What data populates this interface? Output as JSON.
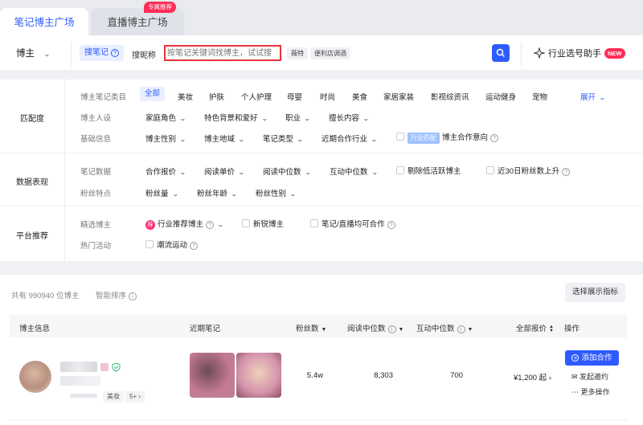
{
  "tabs": [
    {
      "label": "笔记博主广场",
      "active": true
    },
    {
      "label": "直播博主广场",
      "active": false,
      "badge": "专属推荐"
    }
  ],
  "search": {
    "scope": "博主",
    "mode_active": "搜笔记",
    "mode_other": "搜昵称",
    "placeholder": "按笔记关键词找博主，试试搜",
    "chips": [
      "薇特",
      "便利店调酒"
    ],
    "assistant_label": "行业选号助手",
    "assistant_badge": "NEW"
  },
  "filters": {
    "sections": [
      "匹配度",
      "数据表现",
      "平台推荐"
    ],
    "category_row": {
      "label": "博主笔记类目",
      "active": "全部",
      "options": [
        "美妆",
        "护肤",
        "个人护理",
        "母婴",
        "时尚",
        "美食",
        "家居家装",
        "影视综资讯",
        "运动健身",
        "宠物"
      ],
      "expand": "展开"
    },
    "persona_row": {
      "label": "博主人设",
      "options": [
        "家庭角色",
        "特色背景和爱好",
        "职业",
        "擅长内容"
      ]
    },
    "basic_row": {
      "label": "基础信息",
      "options": [
        "博主性别",
        "博主地域",
        "笔记类型",
        "近期合作行业"
      ],
      "tag": "行业匹配",
      "intent": "博主合作意向"
    },
    "notedata_row": {
      "label": "笔记数据",
      "options": [
        "合作报价",
        "阅读单价",
        "阅读中位数",
        "互动中位数"
      ],
      "checks": [
        "剔除低活跃博主",
        "近30日粉丝数上升"
      ]
    },
    "fans_row": {
      "label": "粉丝特点",
      "options": [
        "粉丝量",
        "粉丝年龄",
        "粉丝性别"
      ]
    },
    "picked_row": {
      "label": "精选博主",
      "jian": "荐",
      "recommend": "行业推荐博主",
      "checks": [
        "新锐博主",
        "笔记/直播均可合作"
      ]
    },
    "hot_row": {
      "label": "热门活动",
      "check": "潮流运动"
    }
  },
  "results": {
    "count_text": "共有 990940 位博主",
    "smart_sort": "智能排序",
    "display_metrics": "选择展示指标",
    "columns": [
      "博主信息",
      "近期笔记",
      "粉丝数",
      "阅读中位数",
      "互动中位数",
      "全部报价",
      "操作"
    ],
    "rows": [
      {
        "tag1": "美妆",
        "tag2": "5+",
        "fans": "5.4w",
        "read_median": "8,303",
        "interact_median": "700",
        "price": "¥1,200 起",
        "add": "添加合作",
        "invite": "发起邀约",
        "more": "更多操作"
      }
    ]
  },
  "colors": {
    "accent": "#2e5bff",
    "badge": "#ff2d55",
    "highlight_border": "#e8333b"
  }
}
